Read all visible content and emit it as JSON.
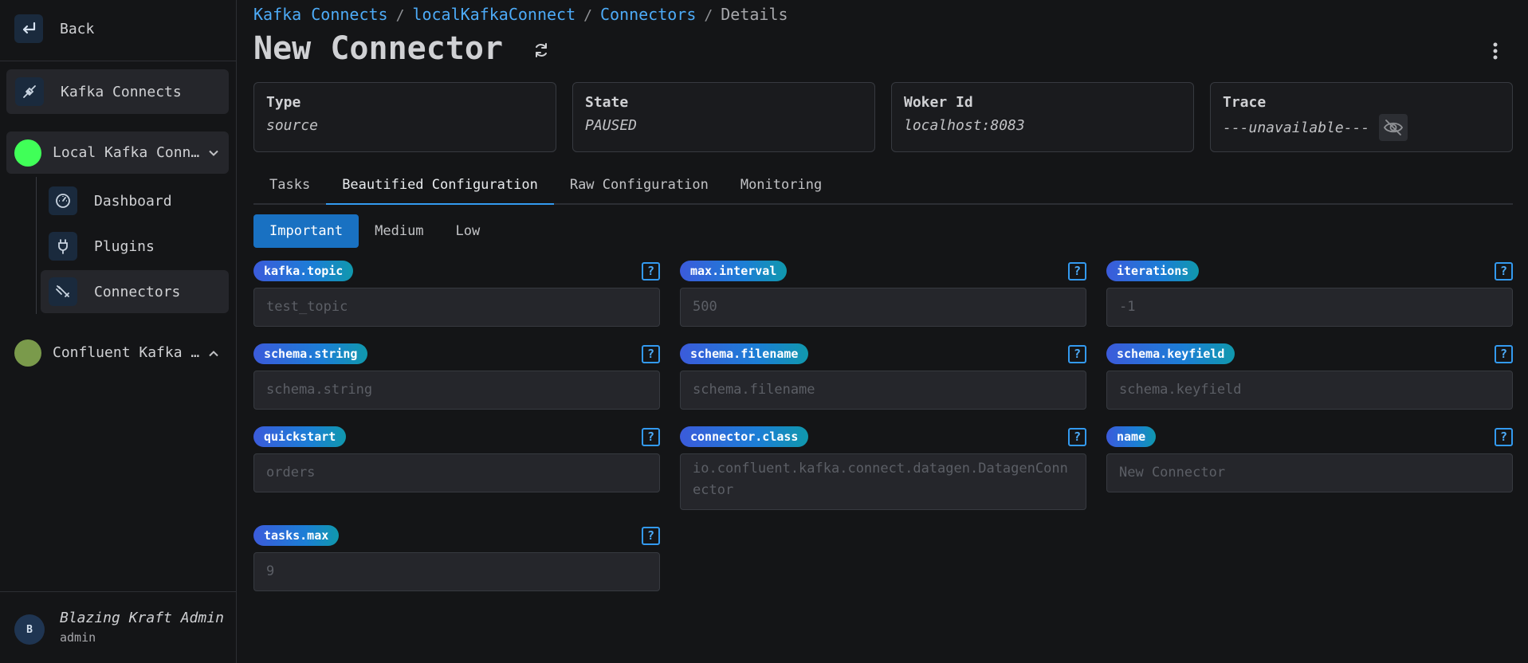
{
  "sidebar": {
    "back_label": "Back",
    "kafka_connects_label": "Kafka Connects",
    "clusters": [
      {
        "label": "Local Kafka Conne…",
        "color": "#40ff58"
      },
      {
        "label": "Confluent Kafka C…",
        "color": "#7a9a4b"
      }
    ],
    "sub_items": [
      {
        "label": "Dashboard",
        "icon": "gauge-icon"
      },
      {
        "label": "Plugins",
        "icon": "plug-icon"
      },
      {
        "label": "Connectors",
        "icon": "connector-icon"
      }
    ],
    "user": {
      "initial": "B",
      "name": "Blazing Kraft Admin",
      "role": "admin"
    }
  },
  "breadcrumb": {
    "items": [
      "Kafka Connects",
      "localKafkaConnect",
      "Connectors"
    ],
    "current": "Details",
    "separator": "/"
  },
  "page": {
    "title": "New Connector"
  },
  "cards": {
    "type": {
      "label": "Type",
      "value": "source"
    },
    "state": {
      "label": "State",
      "value": "PAUSED"
    },
    "worker": {
      "label": "Woker Id",
      "value": "localhost:8083"
    },
    "trace": {
      "label": "Trace",
      "value": "---unavailable---"
    }
  },
  "tabs": [
    "Tasks",
    "Beautified Configuration",
    "Raw Configuration",
    "Monitoring"
  ],
  "active_tab": "Beautified Configuration",
  "importance": [
    "Important",
    "Medium",
    "Low"
  ],
  "active_importance": "Important",
  "help_symbol": "?",
  "fields": [
    {
      "key": "kafka.topic",
      "value": "test_topic"
    },
    {
      "key": "max.interval",
      "value": "500"
    },
    {
      "key": "iterations",
      "value": "-1"
    },
    {
      "key": "schema.string",
      "value": "schema.string"
    },
    {
      "key": "schema.filename",
      "value": "schema.filename"
    },
    {
      "key": "schema.keyfield",
      "value": "schema.keyfield"
    },
    {
      "key": "quickstart",
      "value": "orders"
    },
    {
      "key": "connector.class",
      "value": "io.confluent.kafka.connect.datagen.DatagenConnector"
    },
    {
      "key": "name",
      "value": "New Connector"
    },
    {
      "key": "tasks.max",
      "value": "9"
    }
  ],
  "colors": {
    "accent": "#1971c2",
    "link": "#4dabf7",
    "background": "#141517"
  }
}
